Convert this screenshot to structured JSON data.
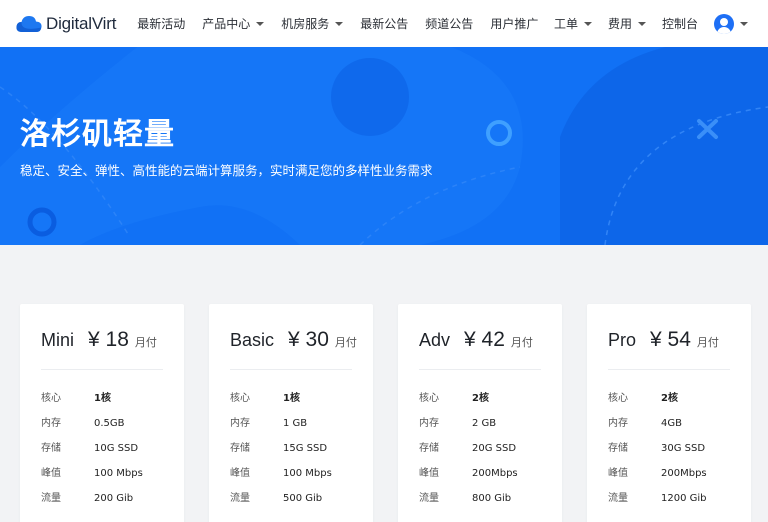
{
  "nav": {
    "brand": "DigitalVirt",
    "items": [
      {
        "label": "最新活动",
        "dropdown": false
      },
      {
        "label": "产品中心",
        "dropdown": true
      },
      {
        "label": "机房服务",
        "dropdown": true
      },
      {
        "label": "最新公告",
        "dropdown": false
      },
      {
        "label": "频道公告",
        "dropdown": false
      },
      {
        "label": "用户推广",
        "dropdown": false
      }
    ],
    "right_items": [
      {
        "label": "工单",
        "dropdown": true
      },
      {
        "label": "费用",
        "dropdown": true
      },
      {
        "label": "控制台",
        "dropdown": false
      }
    ]
  },
  "hero": {
    "title": "洛杉矶轻量",
    "subtitle": "稳定、安全、弹性、高性能的云端计算服务，实时满足您的多样性业务需求"
  },
  "plans": [
    {
      "name": "Mini",
      "price": "¥ 18",
      "period": "月付",
      "specs": [
        {
          "label": "核心",
          "value": "1核"
        },
        {
          "label": "内存",
          "value": "0.5GB"
        },
        {
          "label": "存储",
          "value": "10G SSD"
        },
        {
          "label": "峰值",
          "value": "100 Mbps"
        },
        {
          "label": "流量",
          "value": "200 Gib"
        }
      ]
    },
    {
      "name": "Basic",
      "price": "¥ 30",
      "period": "月付",
      "specs": [
        {
          "label": "核心",
          "value": "1核"
        },
        {
          "label": "内存",
          "value": "1 GB"
        },
        {
          "label": "存储",
          "value": "15G SSD"
        },
        {
          "label": "峰值",
          "value": "100 Mbps"
        },
        {
          "label": "流量",
          "value": "500 Gib"
        }
      ]
    },
    {
      "name": "Adv",
      "price": "¥ 42",
      "period": "月付",
      "specs": [
        {
          "label": "核心",
          "value": "2核"
        },
        {
          "label": "内存",
          "value": "2 GB"
        },
        {
          "label": "存储",
          "value": "20G SSD"
        },
        {
          "label": "峰值",
          "value": "200Mbps"
        },
        {
          "label": "流量",
          "value": "800 Gib"
        }
      ]
    },
    {
      "name": "Pro",
      "price": "¥ 54",
      "period": "月付",
      "specs": [
        {
          "label": "核心",
          "value": "2核"
        },
        {
          "label": "内存",
          "value": "4GB"
        },
        {
          "label": "存储",
          "value": "30G SSD"
        },
        {
          "label": "峰值",
          "value": "200Mbps"
        },
        {
          "label": "流量",
          "value": "1200 Gib"
        }
      ]
    }
  ],
  "colors": {
    "brand_blue": "#1171f5",
    "avatar_blue": "#1e6ff5"
  }
}
